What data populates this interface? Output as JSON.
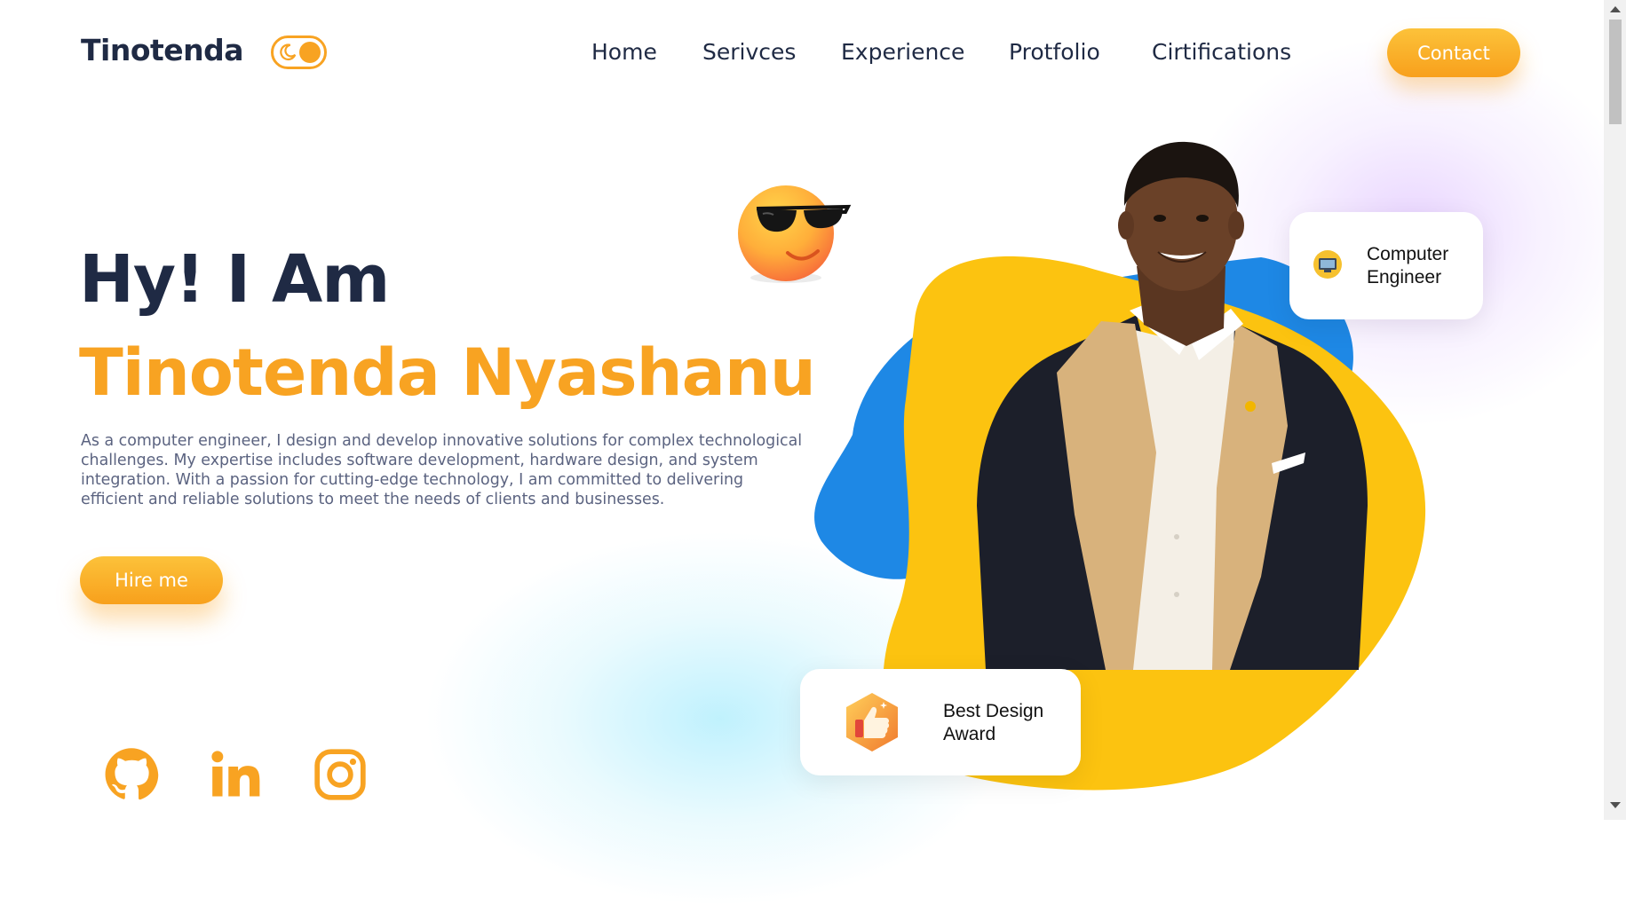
{
  "nav": {
    "logo": "Tinotenda",
    "links": [
      "Home",
      "Serivces",
      "Experience",
      "Protfolio",
      "Cirtifications"
    ],
    "contact_label": "Contact"
  },
  "hero": {
    "greeting": "Hy! I Am",
    "name": "Tinotenda Nyashanu",
    "description": "As a computer engineer, I design and develop innovative solutions for complex technological challenges. My expertise includes software development, hardware design, and system integration. With a passion for cutting-edge technology, I am committed to delivering efficient and reliable solutions to meet the needs of clients and businesses.",
    "hire_label": "Hire me"
  },
  "badges": {
    "engineer": "Computer Engineer",
    "award": "Best Design Award"
  },
  "social": [
    "github-icon",
    "linkedin-icon",
    "instagram-icon"
  ],
  "colors": {
    "accent": "#f8a322",
    "dark_text": "#1f2a44",
    "blob_yellow": "#fcc310",
    "blob_blue": "#1e88e5"
  }
}
